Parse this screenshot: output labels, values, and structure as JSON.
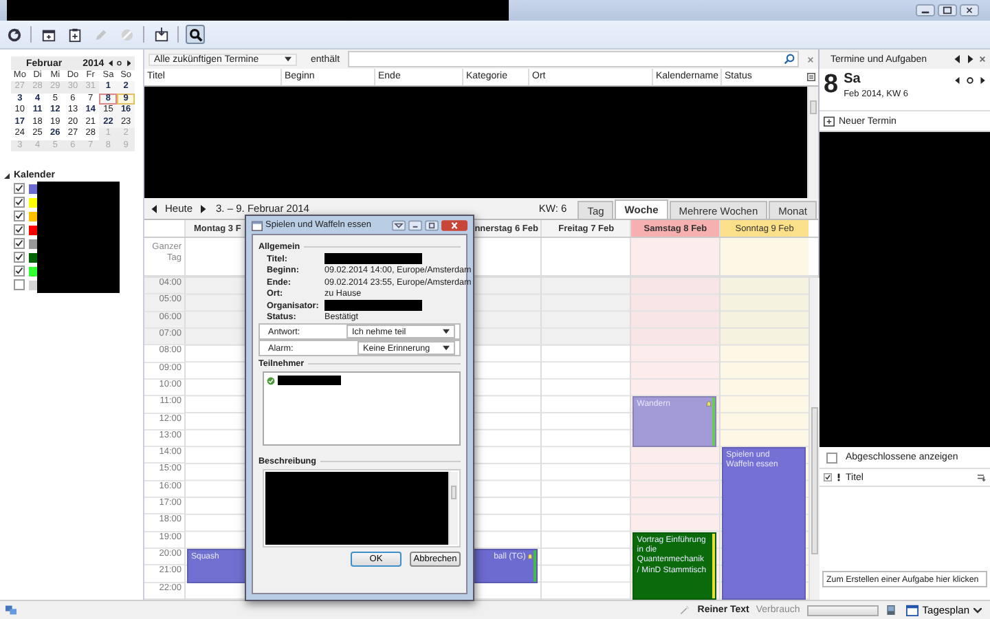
{
  "toolbar": {
    "buttons": [
      {
        "kind": "sync",
        "disabled": false,
        "selected": false
      },
      {
        "kind": "new-event",
        "disabled": false,
        "selected": false
      },
      {
        "kind": "new-task",
        "disabled": false,
        "selected": false
      },
      {
        "kind": "edit",
        "disabled": true,
        "selected": false
      },
      {
        "kind": "delete",
        "disabled": true,
        "selected": false
      },
      {
        "kind": "import",
        "disabled": false,
        "selected": false
      },
      {
        "kind": "search",
        "disabled": false,
        "selected": true
      }
    ]
  },
  "minical": {
    "month": "Februar",
    "year": "2014",
    "weekdays": [
      "Mo",
      "Di",
      "Mi",
      "Do",
      "Fr",
      "Sa",
      "So"
    ],
    "weeks": [
      [
        {
          "label": "27",
          "muted": true,
          "bold": false,
          "today": false,
          "selected": false
        },
        {
          "label": "28",
          "muted": true,
          "bold": false,
          "today": false,
          "selected": false
        },
        {
          "label": "29",
          "muted": true,
          "bold": false,
          "today": false,
          "selected": false
        },
        {
          "label": "30",
          "muted": true,
          "bold": false,
          "today": false,
          "selected": false
        },
        {
          "label": "31",
          "muted": true,
          "bold": false,
          "today": false,
          "selected": false
        },
        {
          "label": "1",
          "muted": false,
          "bold": true,
          "today": false,
          "selected": false
        },
        {
          "label": "2",
          "muted": false,
          "bold": true,
          "today": false,
          "selected": false
        }
      ],
      [
        {
          "label": "3",
          "muted": false,
          "bold": true,
          "today": false,
          "selected": false
        },
        {
          "label": "4",
          "muted": false,
          "bold": true,
          "today": false,
          "selected": false
        },
        {
          "label": "5",
          "muted": false,
          "bold": false,
          "today": false,
          "selected": false
        },
        {
          "label": "6",
          "muted": false,
          "bold": false,
          "today": false,
          "selected": false
        },
        {
          "label": "7",
          "muted": false,
          "bold": false,
          "today": false,
          "selected": false
        },
        {
          "label": "8",
          "muted": false,
          "bold": true,
          "today": true,
          "selected": false
        },
        {
          "label": "9",
          "muted": false,
          "bold": true,
          "today": false,
          "selected": true
        }
      ],
      [
        {
          "label": "10",
          "muted": false,
          "bold": false,
          "today": false,
          "selected": false
        },
        {
          "label": "11",
          "muted": false,
          "bold": true,
          "today": false,
          "selected": false
        },
        {
          "label": "12",
          "muted": false,
          "bold": true,
          "today": false,
          "selected": false
        },
        {
          "label": "13",
          "muted": false,
          "bold": false,
          "today": false,
          "selected": false
        },
        {
          "label": "14",
          "muted": false,
          "bold": true,
          "today": false,
          "selected": false
        },
        {
          "label": "15",
          "muted": false,
          "bold": false,
          "today": false,
          "selected": false
        },
        {
          "label": "16",
          "muted": false,
          "bold": true,
          "today": false,
          "selected": false
        }
      ],
      [
        {
          "label": "17",
          "muted": false,
          "bold": true,
          "today": false,
          "selected": false
        },
        {
          "label": "18",
          "muted": false,
          "bold": false,
          "today": false,
          "selected": false
        },
        {
          "label": "19",
          "muted": false,
          "bold": false,
          "today": false,
          "selected": false
        },
        {
          "label": "20",
          "muted": false,
          "bold": false,
          "today": false,
          "selected": false
        },
        {
          "label": "21",
          "muted": false,
          "bold": false,
          "today": false,
          "selected": false
        },
        {
          "label": "22",
          "muted": false,
          "bold": true,
          "today": false,
          "selected": false
        },
        {
          "label": "23",
          "muted": false,
          "bold": false,
          "today": false,
          "selected": false
        }
      ],
      [
        {
          "label": "24",
          "muted": false,
          "bold": false,
          "today": false,
          "selected": false
        },
        {
          "label": "25",
          "muted": false,
          "bold": false,
          "today": false,
          "selected": false
        },
        {
          "label": "26",
          "muted": false,
          "bold": true,
          "today": false,
          "selected": false
        },
        {
          "label": "27",
          "muted": false,
          "bold": false,
          "today": false,
          "selected": false
        },
        {
          "label": "28",
          "muted": false,
          "bold": false,
          "today": false,
          "selected": false
        },
        {
          "label": "1",
          "muted": true,
          "bold": false,
          "today": false,
          "selected": false
        },
        {
          "label": "2",
          "muted": true,
          "bold": false,
          "today": false,
          "selected": false
        }
      ],
      [
        {
          "label": "3",
          "muted": true,
          "bold": false,
          "today": false,
          "selected": false
        },
        {
          "label": "4",
          "muted": true,
          "bold": false,
          "today": false,
          "selected": false
        },
        {
          "label": "5",
          "muted": true,
          "bold": false,
          "today": false,
          "selected": false
        },
        {
          "label": "6",
          "muted": true,
          "bold": false,
          "today": false,
          "selected": false
        },
        {
          "label": "7",
          "muted": true,
          "bold": false,
          "today": false,
          "selected": false
        },
        {
          "label": "8",
          "muted": true,
          "bold": false,
          "today": false,
          "selected": false
        },
        {
          "label": "9",
          "muted": true,
          "bold": false,
          "today": false,
          "selected": false
        }
      ]
    ]
  },
  "calendars": {
    "title": "Kalender",
    "expanded": true,
    "items": [
      {
        "checked": true,
        "color": "#6b6bd0"
      },
      {
        "checked": true,
        "color": "#ffff00"
      },
      {
        "checked": true,
        "color": "#ffc000"
      },
      {
        "checked": true,
        "color": "#ff0000"
      },
      {
        "checked": true,
        "color": "#999999"
      },
      {
        "checked": true,
        "color": "#006400"
      },
      {
        "checked": true,
        "color": "#33ff33"
      },
      {
        "checked": false,
        "color": "#d4d4d4"
      }
    ]
  },
  "filter": {
    "range": "Alle zukünftigen Termine",
    "contains_label": "enthält"
  },
  "event_list": {
    "columns": [
      "Titel",
      "Beginn",
      "Ende",
      "Kategorie",
      "Ort",
      "Kalendername",
      "Status"
    ]
  },
  "nav": {
    "today": "Heute",
    "range": "3. – 9. Februar 2014",
    "week": "KW: 6",
    "tabs": [
      {
        "label": "Tag",
        "selected": false
      },
      {
        "label": "Woche",
        "selected": true
      },
      {
        "label": "Mehrere Wochen",
        "selected": false
      },
      {
        "label": "Monat",
        "selected": false
      }
    ]
  },
  "week": {
    "allday_label": "Ganzer Tag",
    "hours": [
      {
        "label": "04:00",
        "off": true
      },
      {
        "label": "05:00",
        "off": true
      },
      {
        "label": "06:00",
        "off": true
      },
      {
        "label": "07:00",
        "off": true
      },
      {
        "label": "08:00",
        "off": false
      },
      {
        "label": "09:00",
        "off": false
      },
      {
        "label": "10:00",
        "off": false
      },
      {
        "label": "11:00",
        "off": false
      },
      {
        "label": "12:00",
        "off": false
      },
      {
        "label": "13:00",
        "off": false
      },
      {
        "label": "14:00",
        "off": false
      },
      {
        "label": "15:00",
        "off": false
      },
      {
        "label": "16:00",
        "off": false
      },
      {
        "label": "17:00",
        "off": false
      },
      {
        "label": "18:00",
        "off": false
      },
      {
        "label": "19:00",
        "off": false
      },
      {
        "label": "20:00",
        "off": false
      },
      {
        "label": "21:00",
        "off": false
      },
      {
        "label": "22:00",
        "off": false
      }
    ],
    "days": [
      {
        "kind": "visible",
        "header": "Montag 3 F",
        "cut_left": false,
        "cut_right": true,
        "today": false,
        "selected": false,
        "slots": [
          {
            "kind": "free"
          },
          {
            "kind": "free"
          },
          {
            "kind": "free"
          },
          {
            "kind": "free"
          },
          {
            "kind": "free"
          },
          {
            "kind": "free"
          },
          {
            "kind": "free"
          },
          {
            "kind": "free"
          },
          {
            "kind": "free"
          },
          {
            "kind": "free"
          },
          {
            "kind": "free"
          },
          {
            "kind": "free"
          },
          {
            "kind": "free"
          },
          {
            "kind": "free"
          },
          {
            "kind": "free"
          },
          {
            "kind": "free"
          },
          {
            "kind": "event",
            "title": "Squash",
            "color": "#7070d0",
            "alarm": false
          },
          {
            "kind": "busy"
          }
        ]
      },
      {
        "kind": "covered"
      },
      {
        "kind": "covered"
      },
      {
        "kind": "visible",
        "header": "nnerstag 6 Feb",
        "cut_left": true,
        "cut_right": false,
        "today": false,
        "selected": false,
        "slots": [
          {
            "kind": "free"
          },
          {
            "kind": "free"
          },
          {
            "kind": "free"
          },
          {
            "kind": "free"
          },
          {
            "kind": "free"
          },
          {
            "kind": "free"
          },
          {
            "kind": "free"
          },
          {
            "kind": "free"
          },
          {
            "kind": "free"
          },
          {
            "kind": "free"
          },
          {
            "kind": "free"
          },
          {
            "kind": "free"
          },
          {
            "kind": "free"
          },
          {
            "kind": "free"
          },
          {
            "kind": "free"
          },
          {
            "kind": "free"
          },
          {
            "kind": "event",
            "title": "ball (TG)",
            "color": "#6b6bd0",
            "bar": {
              "color": "#44bb44"
            },
            "covered": true,
            "alarm": true
          },
          {
            "kind": "busy"
          }
        ]
      },
      {
        "kind": "visible",
        "header": "Freitag 7 Feb",
        "cut_left": false,
        "cut_right": false,
        "today": false,
        "selected": false
      },
      {
        "kind": "visible",
        "header": "Samstag 8 Feb",
        "cut_left": false,
        "cut_right": false,
        "today": true,
        "selected": false,
        "slots": [
          {
            "kind": "free"
          },
          {
            "kind": "free"
          },
          {
            "kind": "free"
          },
          {
            "kind": "free"
          },
          {
            "kind": "free"
          },
          {
            "kind": "free"
          },
          {
            "kind": "free"
          },
          {
            "kind": "event",
            "title": "Wandern",
            "color": "#a39ad8",
            "bar": {
              "color": "#66cc55"
            },
            "alarm": true
          },
          {
            "kind": "busy"
          },
          {
            "kind": "busy"
          },
          {
            "kind": "free"
          },
          {
            "kind": "free"
          },
          {
            "kind": "free"
          },
          {
            "kind": "free"
          },
          {
            "kind": "free"
          },
          {
            "kind": "event",
            "title": "Vortrag Einführung in die Quantenmechanik / MinD Stammtisch",
            "color": "#0b6b0b",
            "bar": {
              "color": "#e8e030"
            },
            "alarm": false
          },
          {
            "kind": "busy"
          },
          {
            "kind": "busy"
          },
          {
            "kind": "busy"
          }
        ]
      },
      {
        "kind": "visible",
        "header": "Sonntag 9 Feb",
        "cut_left": false,
        "cut_right": false,
        "today": false,
        "selected": true,
        "slots": [
          {
            "kind": "free"
          },
          {
            "kind": "free"
          },
          {
            "kind": "free"
          },
          {
            "kind": "free"
          },
          {
            "kind": "free"
          },
          {
            "kind": "free"
          },
          {
            "kind": "free"
          },
          {
            "kind": "free"
          },
          {
            "kind": "free"
          },
          {
            "kind": "free"
          },
          {
            "kind": "event",
            "title": "Spielen und Waffeln essen",
            "color": "#7470d4",
            "alarm": false
          },
          {
            "kind": "busy"
          },
          {
            "kind": "busy"
          },
          {
            "kind": "busy"
          },
          {
            "kind": "busy"
          },
          {
            "kind": "busy"
          },
          {
            "kind": "busy"
          },
          {
            "kind": "busy"
          },
          {
            "kind": "busy"
          }
        ]
      }
    ]
  },
  "dialog": {
    "title": "Spielen und Waffeln essen",
    "general_title": "Allgemein",
    "rows": [
      {
        "label": "Titel:",
        "kind": "redacted"
      },
      {
        "label": "Beginn:",
        "kind": "text",
        "value": "09.02.2014 14:00, Europe/Amsterdam"
      },
      {
        "label": "Ende:",
        "kind": "text",
        "value": "09.02.2014 23:55, Europe/Amsterdam"
      },
      {
        "label": "Ort:",
        "kind": "text",
        "value": "zu Hause"
      },
      {
        "label": "Organisator:",
        "kind": "redacted"
      },
      {
        "label": "Status:",
        "kind": "text",
        "value": "Bestätigt"
      },
      {
        "label": "Antwort:",
        "kind": "select",
        "value": "Ich nehme teil"
      },
      {
        "label": "Alarm:",
        "kind": "select",
        "value": "Keine Erinnerung"
      }
    ],
    "attendees_title": "Teilnehmer",
    "description_title": "Beschreibung",
    "buttons": [
      "OK",
      "Abbrechen"
    ]
  },
  "agenda": {
    "title": "Termine und Aufgaben",
    "day": "8",
    "weekday": "Sa",
    "subtitle": "Feb 2014, KW 6",
    "new_event": "Neuer Termin",
    "show_completed": {
      "label": "Abgeschlossene anzeigen",
      "checked": false
    },
    "task_columns": [
      "Titel"
    ],
    "new_task": {
      "placeholder": "Zum Erstellen einer Aufgabe hier klicken"
    }
  },
  "status_bar": {
    "format": "Reiner Text",
    "usage_label": "Verbrauch",
    "view": "Tagesplan"
  }
}
